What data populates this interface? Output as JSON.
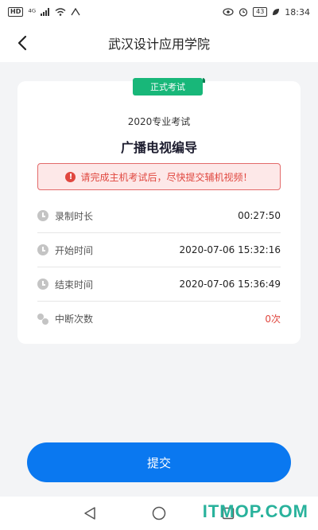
{
  "status_bar": {
    "hd_label": "HD",
    "network": "⁴ᴳ",
    "battery": "43",
    "time": "18:34"
  },
  "header": {
    "title": "武汉设计应用学院"
  },
  "card": {
    "tag": "正式考试",
    "exam_year": "2020专业考试",
    "exam_name": "广播电视编导",
    "alert": "请完成主机考试后，尽快提交辅机视频！",
    "rows": [
      {
        "label": "录制时长",
        "value": "00:27:50"
      },
      {
        "label": "开始时间",
        "value": "2020-07-06 15:32:16"
      },
      {
        "label": "结束时间",
        "value": "2020-07-06 15:36:49"
      },
      {
        "label": "中断次数",
        "value": "0次"
      }
    ]
  },
  "submit_label": "提交",
  "watermark": "ITMOP.COM",
  "colors": {
    "accent": "#0a78f0",
    "tag_green": "#18b779",
    "alert_red": "#e0473f"
  }
}
